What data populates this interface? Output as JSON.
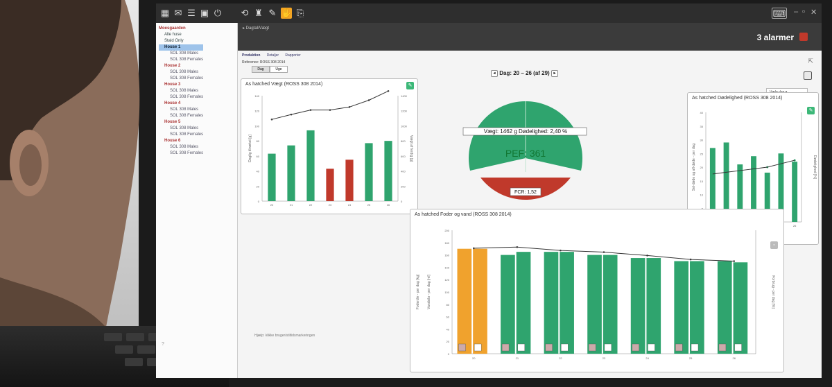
{
  "toolbar": {
    "window_controls": [
      "–",
      "▫",
      "✕"
    ]
  },
  "breadcrumb": "▸ Dagtal/Vægt",
  "alarms": "3 alarmer",
  "sidebar": {
    "root": "Moesgaarden",
    "items": [
      {
        "label": "Alle huse",
        "level": "leaf"
      },
      {
        "label": "Stald Only",
        "level": "leaf"
      },
      {
        "label": "House 1",
        "level": "house",
        "selected": true
      },
      {
        "label": "SOL 308 Males",
        "level": "leaf"
      },
      {
        "label": "SOL 308 Females",
        "level": "leaf"
      },
      {
        "label": "House 2",
        "level": "house"
      },
      {
        "label": "SOL 308 Males",
        "level": "leaf"
      },
      {
        "label": "SOL 308 Females",
        "level": "leaf"
      },
      {
        "label": "House 3",
        "level": "house"
      },
      {
        "label": "SOL 308 Males",
        "level": "leaf"
      },
      {
        "label": "SOL 308 Females",
        "level": "leaf"
      },
      {
        "label": "House 4",
        "level": "house"
      },
      {
        "label": "SOL 308 Males",
        "level": "leaf"
      },
      {
        "label": "SOL 308 Females",
        "level": "leaf"
      },
      {
        "label": "House 5",
        "level": "house"
      },
      {
        "label": "SOL 308 Males",
        "level": "leaf"
      },
      {
        "label": "SOL 308 Females",
        "level": "leaf"
      },
      {
        "label": "House 6",
        "level": "house"
      },
      {
        "label": "SOL 308 Males",
        "level": "leaf"
      },
      {
        "label": "SOL 308 Females",
        "level": "leaf"
      }
    ],
    "footer": "?"
  },
  "main": {
    "tabs": [
      "Produktion",
      "Detaljer",
      "Rapporter"
    ],
    "reference": "Reference: ROSS 308 2014",
    "toggle": [
      "Dag",
      "Uge"
    ],
    "day_nav": "Dag: 20 – 26 (af 29)",
    "dropdown": "Vælg dag",
    "bottom_note": "Hjælp: klikke bruger/stiltidsmarkeringen"
  },
  "weight_panel": {
    "title": "As hatched  Vægt (ROSS 308 2014)",
    "ylabel_left": "Daglig tilvækst [g]",
    "ylabel_right": "Vægt af ferdig [g]",
    "colors": {
      "ok": "#2fa46e",
      "bad": "#c0392b"
    }
  },
  "pie": {
    "weight_label": "Vægt: 1462 g",
    "mortality_label": "Dødelighed: 2,40 %",
    "pef_label": "PEF: 361",
    "fcr_label": "FCR: 1,52",
    "colors": {
      "top": "#2fa46e",
      "bottom": "#c0392b"
    }
  },
  "mortality_panel": {
    "title": "As hatched  Dødelighed (ROSS 308 2014)",
    "ylabel_left": "Sel-døde og afl-døde - per dag",
    "ylabel_right": "Dødelighed [%]"
  },
  "feed_panel": {
    "title": "As hatched Foder og vand (ROSS 308 2014)",
    "ylabel_left": "Foderdiv - per dag [kg]",
    "ylabel_left2": "Vandsilo - per dag [ml]",
    "ylabel_right": "Forbrug - per dag [%]",
    "colors": {
      "first": "#f0a22d",
      "rest": "#2fa46e"
    }
  },
  "chart_data": [
    {
      "type": "bar",
      "title": "As hatched  Vægt (ROSS 308 2014)",
      "categories": [
        "20",
        "21",
        "22",
        "23",
        "24",
        "25",
        "26"
      ],
      "series": [
        {
          "values": [
            63,
            74,
            94,
            43,
            55,
            77,
            80
          ]
        },
        {
          "values": [
            1085,
            1150,
            1210,
            1210,
            1250,
            1340,
            1462
          ]
        }
      ]
    },
    {
      "type": "pie",
      "categories": [
        "Vægt/Dødelighed",
        "FCR"
      ],
      "values": [
        70,
        30
      ]
    },
    {
      "type": "bar",
      "title": "As hatched  Dødelighed (ROSS 308 2014)",
      "categories": [
        "20",
        "21",
        "22",
        "23",
        "24",
        "25",
        "26"
      ],
      "series": [
        {
          "values": [
            27,
            29,
            21,
            24,
            18,
            25,
            22
          ]
        },
        {
          "values": [
            1.4,
            1.45,
            1.5,
            1.55,
            1.6,
            1.7,
            1.8
          ]
        }
      ]
    },
    {
      "type": "bar",
      "title": "As hatched Foder og vand (ROSS 308 2014)",
      "categories": [
        "20",
        "21",
        "22",
        "23",
        "24",
        "25",
        "26"
      ],
      "series": [
        {
          "values": [
            170,
            160,
            165,
            160,
            155,
            150,
            150
          ]
        },
        {
          "values": [
            170,
            165,
            165,
            160,
            155,
            150,
            148
          ]
        },
        {
          "values": [
            188,
            190,
            184,
            181,
            175,
            168,
            165
          ]
        }
      ]
    }
  ]
}
